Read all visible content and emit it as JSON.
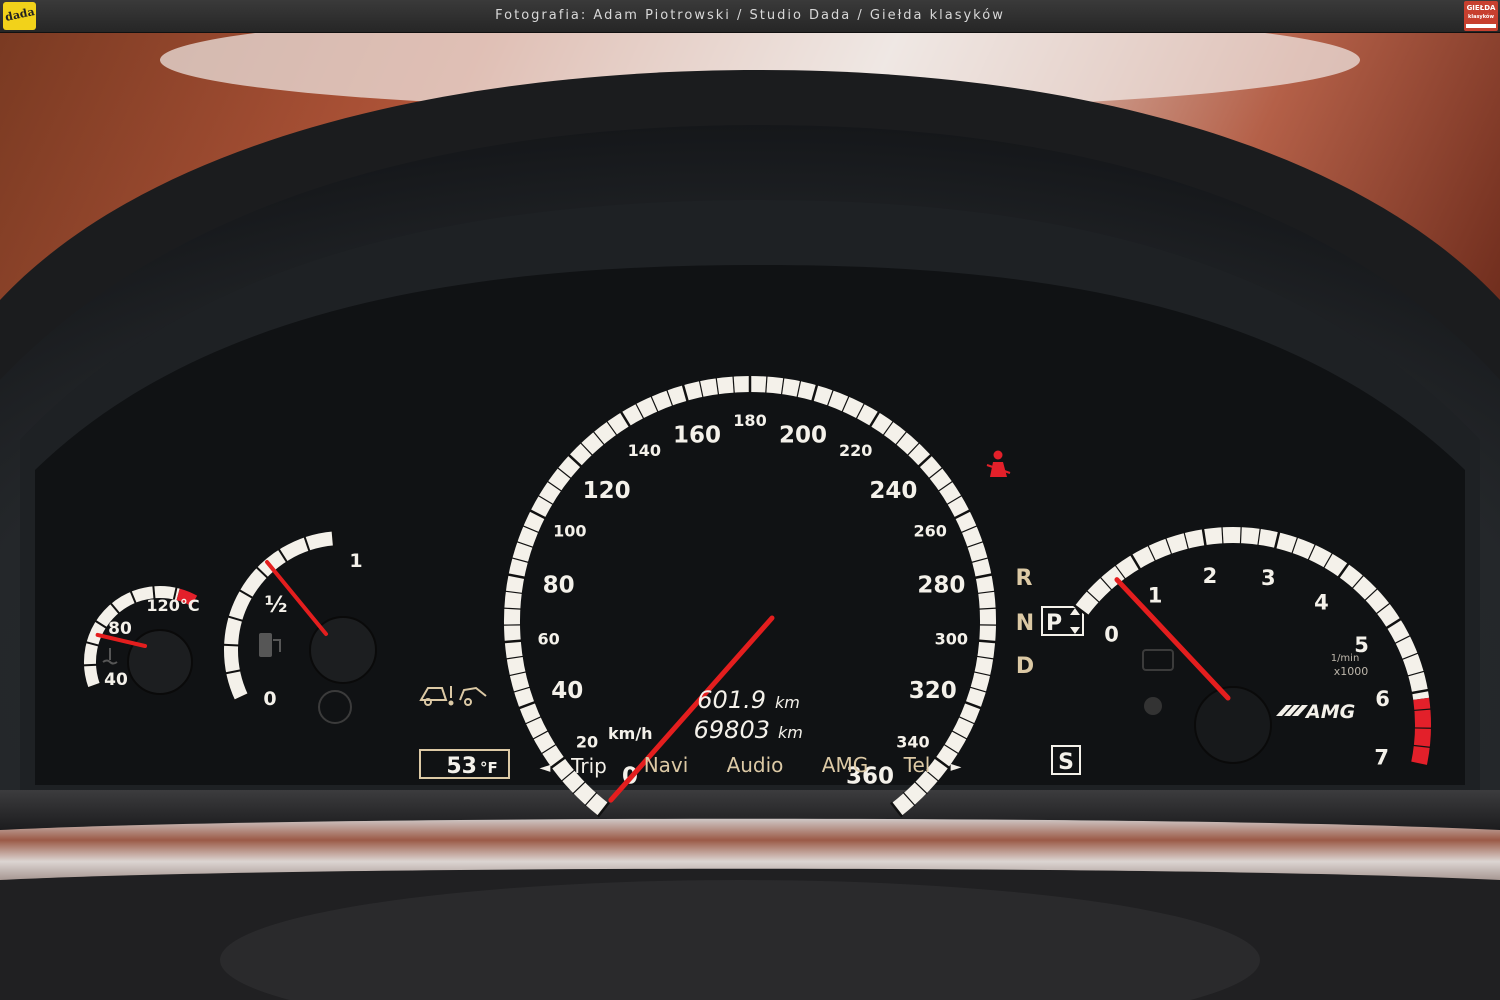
{
  "header": {
    "credit": "Fotografia: Adam Piotrowski / Studio Dada / Giełda klasyków",
    "logo_left": "dada",
    "logo_right_line1": "GIEŁDA",
    "logo_right_line2": "klasyków"
  },
  "dashboard": {
    "temperature_gauge": {
      "labels": [
        "40",
        "80",
        "120°C"
      ],
      "needle_celsius": 82
    },
    "fuel_gauge": {
      "labels": [
        "0",
        "½",
        "1"
      ],
      "needle_fraction": 0.62
    },
    "speedometer": {
      "major_labels": [
        "0",
        "40",
        "80",
        "120",
        "160",
        "200",
        "240",
        "280",
        "320",
        "360"
      ],
      "minor_labels": [
        "20",
        "60",
        "100",
        "140",
        "180",
        "220",
        "260",
        "300",
        "340"
      ],
      "unit": "km/h",
      "needle_kmh": 0
    },
    "odometer": {
      "trip_value": "601.9",
      "trip_unit": "km",
      "total_value": "69803",
      "total_unit": "km"
    },
    "outside_temp": {
      "value": "53",
      "unit": "°F"
    },
    "menu": {
      "items": [
        "Trip",
        "Navi",
        "Audio",
        "AMG",
        "Tel"
      ],
      "left_arrow": "◄",
      "right_arrow": "►"
    },
    "gear": {
      "r": "R",
      "n": "N",
      "d": "D",
      "selected": "P",
      "mode": "S"
    },
    "tachometer": {
      "labels": [
        "0",
        "1",
        "2",
        "3",
        "4",
        "5",
        "6",
        "7"
      ],
      "unit_line1": "1/min",
      "unit_line2": "x1000",
      "needle_rpm_x1000": 0.65,
      "brand": "AMG"
    },
    "colors": {
      "needle": "#e41e1e",
      "scale": "#f4f1ea",
      "redzone": "#e3202a",
      "amber_text": "#dcc9a5"
    }
  }
}
